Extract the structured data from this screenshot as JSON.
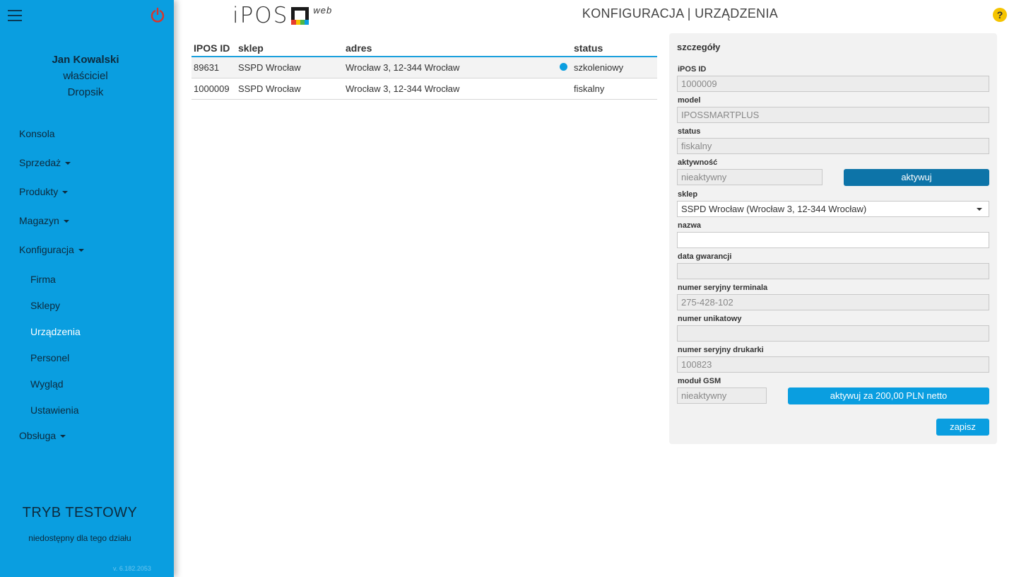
{
  "sidebar": {
    "user": {
      "name": "Jan Kowalski",
      "role": "właściciel",
      "company": "Dropsik"
    },
    "nav": [
      {
        "label": "Konsola",
        "has_caret": false
      },
      {
        "label": "Sprzedaż",
        "has_caret": true
      },
      {
        "label": "Produkty",
        "has_caret": true
      },
      {
        "label": "Magazyn",
        "has_caret": true
      },
      {
        "label": "Konfiguracja",
        "has_caret": true
      }
    ],
    "sub_nav": [
      {
        "label": "Firma"
      },
      {
        "label": "Sklepy"
      },
      {
        "label": "Urządzenia",
        "active": true
      },
      {
        "label": "Personel"
      },
      {
        "label": "Wygląd"
      },
      {
        "label": "Ustawienia"
      }
    ],
    "nav_after": {
      "label": "Obsługa"
    },
    "test_mode": "TRYB TESTOWY",
    "test_note": "niedostępny dla tego działu",
    "version": "v. 6.182.2053"
  },
  "header": {
    "logo_text": "iPOS",
    "logo_suffix": "web",
    "title": "KONFIGURACJA | URZĄDZENIA",
    "help": "?"
  },
  "table": {
    "columns": {
      "id": "IPOS ID",
      "shop": "sklep",
      "address": "adres",
      "status": "status"
    },
    "rows": [
      {
        "id": "89631",
        "shop": "SSPD Wrocław",
        "address": "Wrocław 3, 12-344 Wrocław",
        "status": "szkoleniowy",
        "dot": true
      },
      {
        "id": "1000009",
        "shop": "SSPD Wrocław",
        "address": "Wrocław 3, 12-344 Wrocław",
        "status": "fiskalny",
        "dot": false
      }
    ]
  },
  "details": {
    "title": "szczegóły",
    "ipos_id": {
      "label": "iPOS ID",
      "value": "1000009"
    },
    "model": {
      "label": "model",
      "value": "IPOSSMARTPLUS"
    },
    "status": {
      "label": "status",
      "value": "fiskalny"
    },
    "activity": {
      "label": "aktywność",
      "value": "nieaktywny",
      "button": "aktywuj"
    },
    "shop": {
      "label": "sklep",
      "value": "SSPD Wrocław (Wrocław 3, 12-344 Wrocław)"
    },
    "name": {
      "label": "nazwa",
      "value": ""
    },
    "warranty": {
      "label": "data gwarancji",
      "value": ""
    },
    "terminal_serial": {
      "label": "numer seryjny terminala",
      "value": "275-428-102"
    },
    "unique_number": {
      "label": "numer unikatowy",
      "value": ""
    },
    "printer_serial": {
      "label": "numer seryjny drukarki",
      "value": "100823"
    },
    "gsm": {
      "label": "moduł GSM",
      "value": "nieaktywny",
      "button": "aktywuj za 200,00 PLN netto"
    },
    "save": "zapisz"
  },
  "colors": {
    "sidebar": "#0a9ee0",
    "accent": "#0a9ee0",
    "button_dark": "#0d74a8",
    "power": "#d9342b",
    "help": "#f5c400"
  }
}
